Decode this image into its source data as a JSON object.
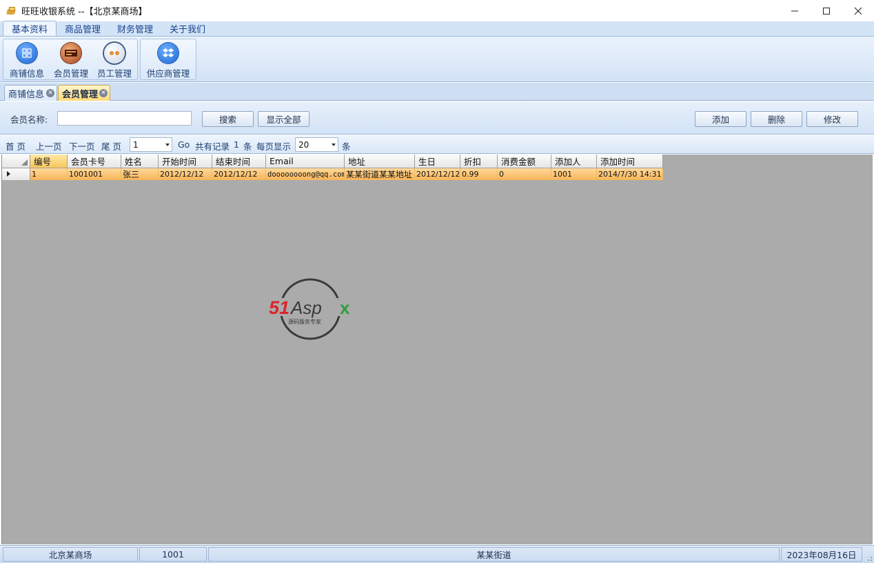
{
  "window": {
    "title": "旺旺收银系统 --【北京某商场】",
    "controls": {
      "minimize": "─",
      "maximize": "☐",
      "close": "✕"
    }
  },
  "ribbon": {
    "tabs": [
      "基本资料",
      "商品管理",
      "财务管理",
      "关于我们"
    ],
    "active_tab": "基本资料",
    "buttons": [
      {
        "label": "商铺信息",
        "icon": "grid-icon"
      },
      {
        "label": "会员管理",
        "icon": "member-card-icon"
      },
      {
        "label": "员工管理",
        "icon": "staff-face-icon"
      },
      {
        "label": "供应商管理",
        "icon": "dropbox-icon"
      }
    ]
  },
  "doc_tabs": [
    {
      "label": "商铺信息",
      "close": "✕"
    },
    {
      "label": "会员管理",
      "close": "✕"
    }
  ],
  "search": {
    "member_name_label": "会员名称:",
    "member_name_value": "",
    "search_button": "搜索",
    "show_all_button": "显示全部",
    "add_button": "添加",
    "delete_button": "删除",
    "edit_button": "修改"
  },
  "pager": {
    "first": "首 页",
    "prev": "上一页",
    "next": "下一页",
    "last": "尾 页",
    "page_value": "1",
    "go": "Go",
    "total_label": "共有记录",
    "total_count": "1",
    "total_unit": "条",
    "per_page_label": "每页显示",
    "per_page_value": "20",
    "per_page_unit": "条"
  },
  "grid": {
    "columns": [
      "编号",
      "会员卡号",
      "姓名",
      "开始时间",
      "结束时间",
      "Email",
      "地址",
      "生日",
      "折扣",
      "消费金额",
      "添加人",
      "添加时间"
    ],
    "rows": [
      [
        "1",
        "1001001",
        "张三",
        "2012/12/12",
        "2012/12/12",
        "doooooooong@qq.com",
        "某某街道某某地址",
        "2012/12/12",
        "0.99",
        "0",
        "1001",
        "2014/7/30 14:31"
      ]
    ]
  },
  "watermark": {
    "brand_main": "51Aspx",
    "brand_sub": "源码服务专家"
  },
  "status_bar": {
    "store": "北京某商场",
    "user": "1001",
    "address": "某某街道",
    "date": "2023年08月16日"
  },
  "colors": {
    "ribbon_bg": "#d4e4f7",
    "grid_bg": "#ababab",
    "selected_row": "#f7b458",
    "header_text": "#15428b",
    "watermark_red": "#d9252b",
    "watermark_green": "#2e9e3e"
  }
}
